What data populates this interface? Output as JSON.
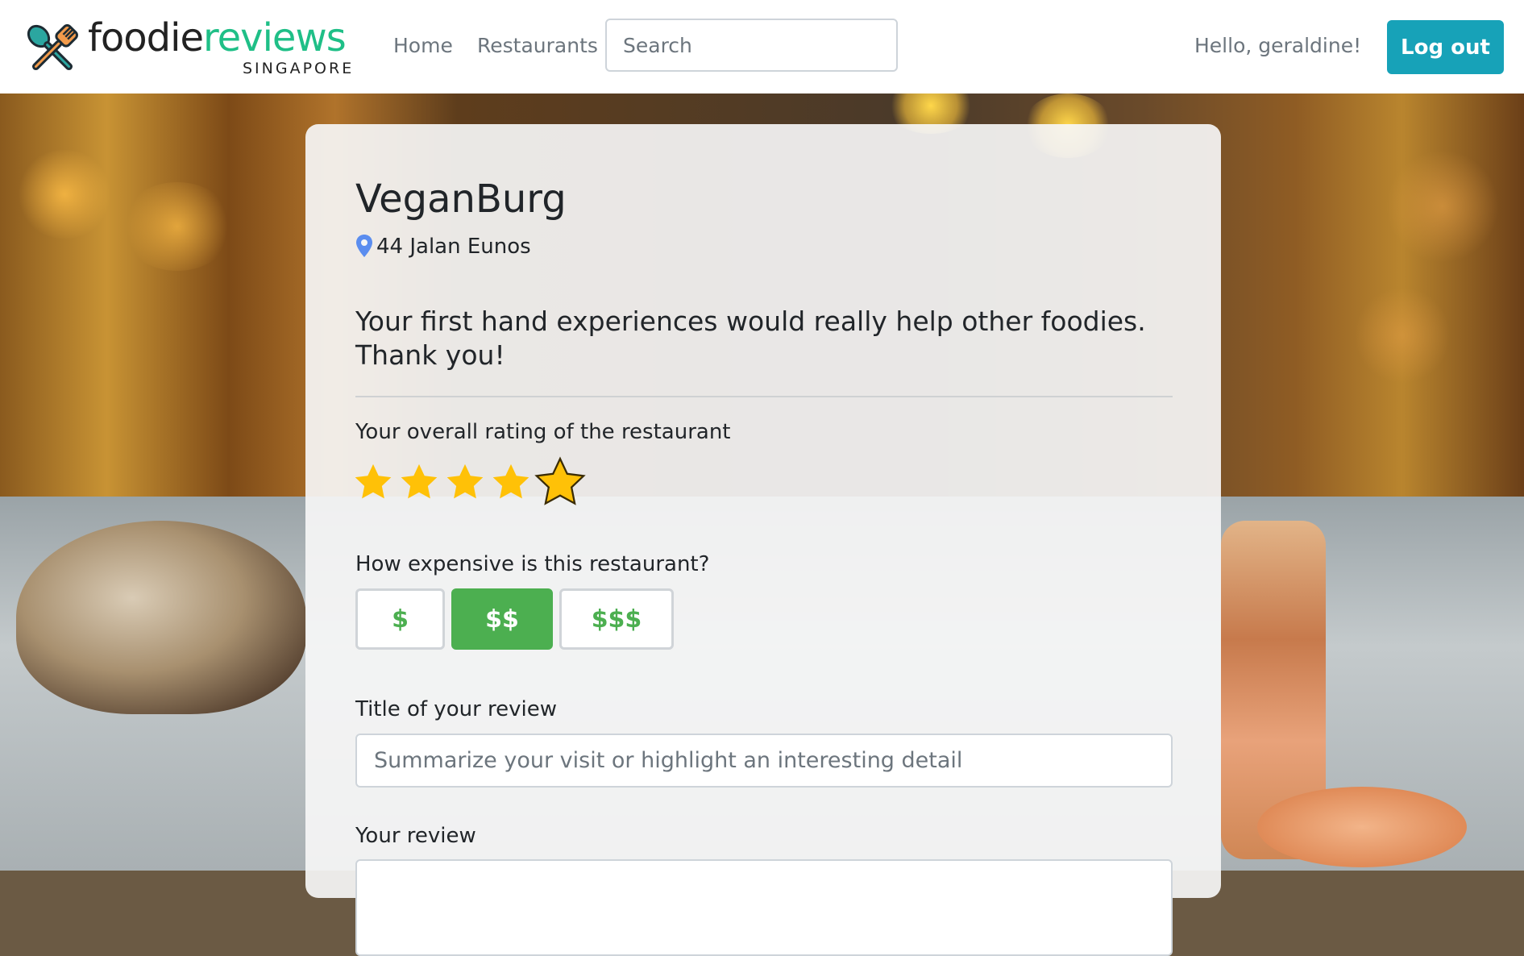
{
  "navbar": {
    "brand": {
      "word_part1": "foodie",
      "word_part2": "reviews",
      "subtitle": "SINGAPORE",
      "icon": "utensils-cross-icon"
    },
    "links": [
      {
        "label": "Home"
      },
      {
        "label": "Restaurants"
      }
    ],
    "search": {
      "placeholder": "Search",
      "value": ""
    },
    "greeting": "Hello, geraldine!",
    "logout_label": "Log out"
  },
  "restaurant": {
    "name": "VeganBurg",
    "address": "44 Jalan Eunos",
    "address_icon": "map-pin-icon"
  },
  "form": {
    "lead": "Your first hand experiences would really help other foodies. Thank you!",
    "rating": {
      "label": "Your overall rating of the restaurant",
      "value": 5,
      "max": 5,
      "icon": "star-icon",
      "color": "#ffc107"
    },
    "price": {
      "label": "How expensive is this restaurant?",
      "options": [
        "$",
        "$$",
        "$$$"
      ],
      "selected": "$$"
    },
    "title_field": {
      "label": "Title of your review",
      "placeholder": "Summarize your visit or highlight an interesting detail",
      "value": ""
    },
    "review_field": {
      "label": "Your review"
    }
  },
  "colors": {
    "brand_green": "#1fbf87",
    "logout_bg": "#17a2b8",
    "price_green": "#4caf50",
    "star_gold": "#ffc107"
  }
}
